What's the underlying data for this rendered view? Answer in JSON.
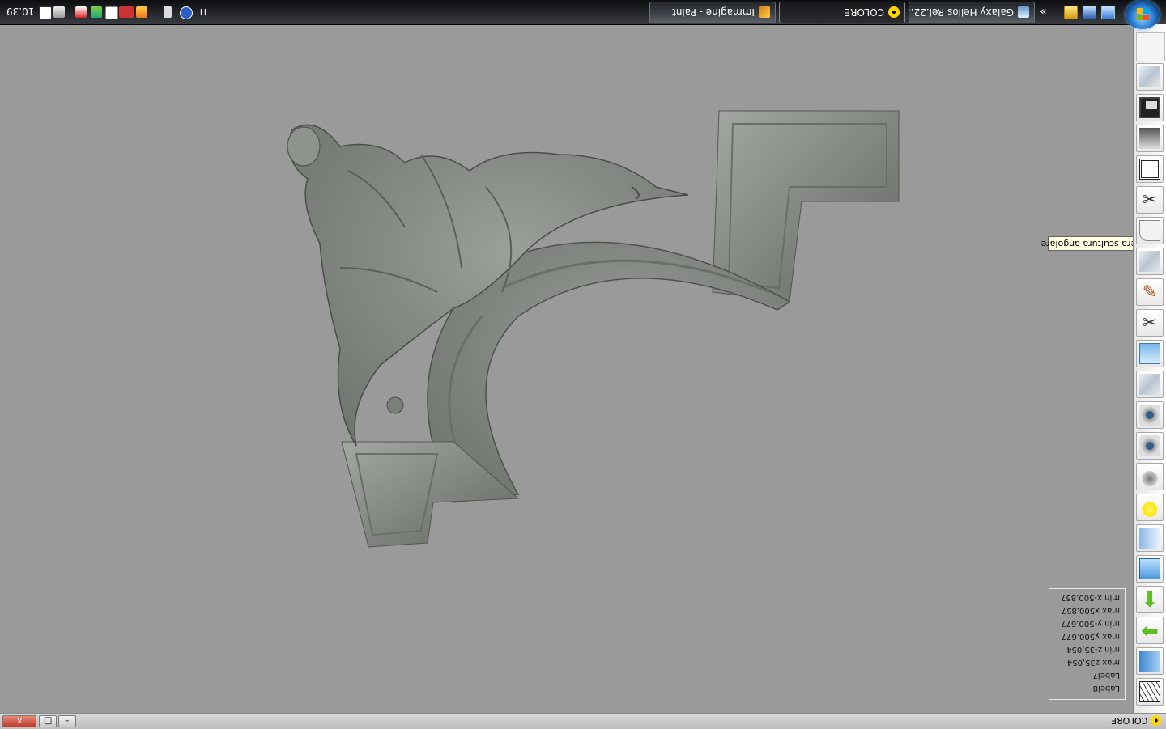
{
  "taskbar": {
    "clock": "10.39",
    "language": "IT",
    "tasks": [
      {
        "label": "Galaxy Helios Rel.22....",
        "icon": "galaxy-icon"
      },
      {
        "label": "COLORE",
        "icon": "radiation-icon"
      },
      {
        "label": "Immagine - Paint",
        "icon": "paint-icon"
      }
    ],
    "overflow_label": "»"
  },
  "viewport": {
    "object": "genera scultura angolare - carved corner ornament",
    "background_color": "#9a9a9a",
    "material_color": "#8c9089"
  },
  "tooltip": {
    "text": "genera scultura angolare"
  },
  "info": {
    "lines": [
      "Label8",
      "Label7",
      "max z35,054",
      "min z-35,054",
      "max y500,677",
      "min y-500,677",
      "max x500,857",
      "min x-500,857"
    ]
  },
  "toolbar": {
    "buttons": [
      {
        "name": "texture-icon"
      },
      {
        "name": "floppy-disk-icon"
      },
      {
        "name": "printer-icon"
      },
      {
        "name": "frame-icon"
      },
      {
        "name": "scissors-icon"
      },
      {
        "name": "corner-sculpture-icon"
      },
      {
        "name": "texture-icon"
      },
      {
        "name": "pencil-icon"
      },
      {
        "name": "scissors-icon"
      },
      {
        "name": "window-icon"
      },
      {
        "name": "texture-icon"
      },
      {
        "name": "camera-icon"
      },
      {
        "name": "camera-icon"
      },
      {
        "name": "light-off-icon"
      },
      {
        "name": "light-on-icon"
      },
      {
        "name": "gradient-icon"
      },
      {
        "name": "info-panel-icon"
      },
      {
        "name": "arrow-down-icon"
      },
      {
        "name": "arrow-left-icon"
      },
      {
        "name": "blue-panel-icon"
      },
      {
        "name": "wireframe-icon"
      }
    ]
  },
  "statusbar": {
    "title": "COLORE",
    "close_label": "x",
    "max_label": "□",
    "min_label": "–"
  }
}
